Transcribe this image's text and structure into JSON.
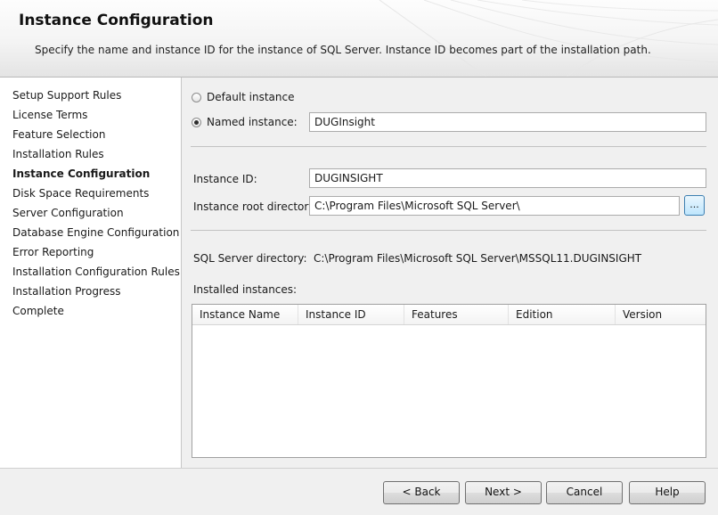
{
  "header": {
    "title": "Instance Configuration",
    "subtitle": "Specify the name and instance ID for the instance of SQL Server. Instance ID becomes part of the installation path."
  },
  "sidebar": {
    "steps": [
      {
        "label": "Setup Support Rules",
        "active": false
      },
      {
        "label": "License Terms",
        "active": false
      },
      {
        "label": "Feature Selection",
        "active": false
      },
      {
        "label": "Installation Rules",
        "active": false
      },
      {
        "label": "Instance Configuration",
        "active": true
      },
      {
        "label": "Disk Space Requirements",
        "active": false
      },
      {
        "label": "Server Configuration",
        "active": false
      },
      {
        "label": "Database Engine Configuration",
        "active": false
      },
      {
        "label": "Error Reporting",
        "active": false
      },
      {
        "label": "Installation Configuration Rules",
        "active": false
      },
      {
        "label": "Installation Progress",
        "active": false
      },
      {
        "label": "Complete",
        "active": false
      }
    ]
  },
  "form": {
    "default_instance_label": "Default instance",
    "named_instance_label": "Named instance:",
    "named_instance_value": "DUGInsight",
    "selected_option": "named",
    "instance_id_label": "Instance ID:",
    "instance_id_value": "DUGINSIGHT",
    "root_dir_label": "Instance root directory:",
    "root_dir_value": "C:\\Program Files\\Microsoft SQL Server\\",
    "browse_label": "...",
    "sql_dir_label": "SQL Server directory:",
    "sql_dir_value": "C:\\Program Files\\Microsoft SQL Server\\MSSQL11.DUGINSIGHT",
    "installed_label": "Installed instances:"
  },
  "table": {
    "columns": [
      "Instance Name",
      "Instance ID",
      "Features",
      "Edition",
      "Version"
    ],
    "rows": []
  },
  "footer": {
    "back": "< Back",
    "next": "Next >",
    "cancel": "Cancel",
    "help": "Help"
  }
}
